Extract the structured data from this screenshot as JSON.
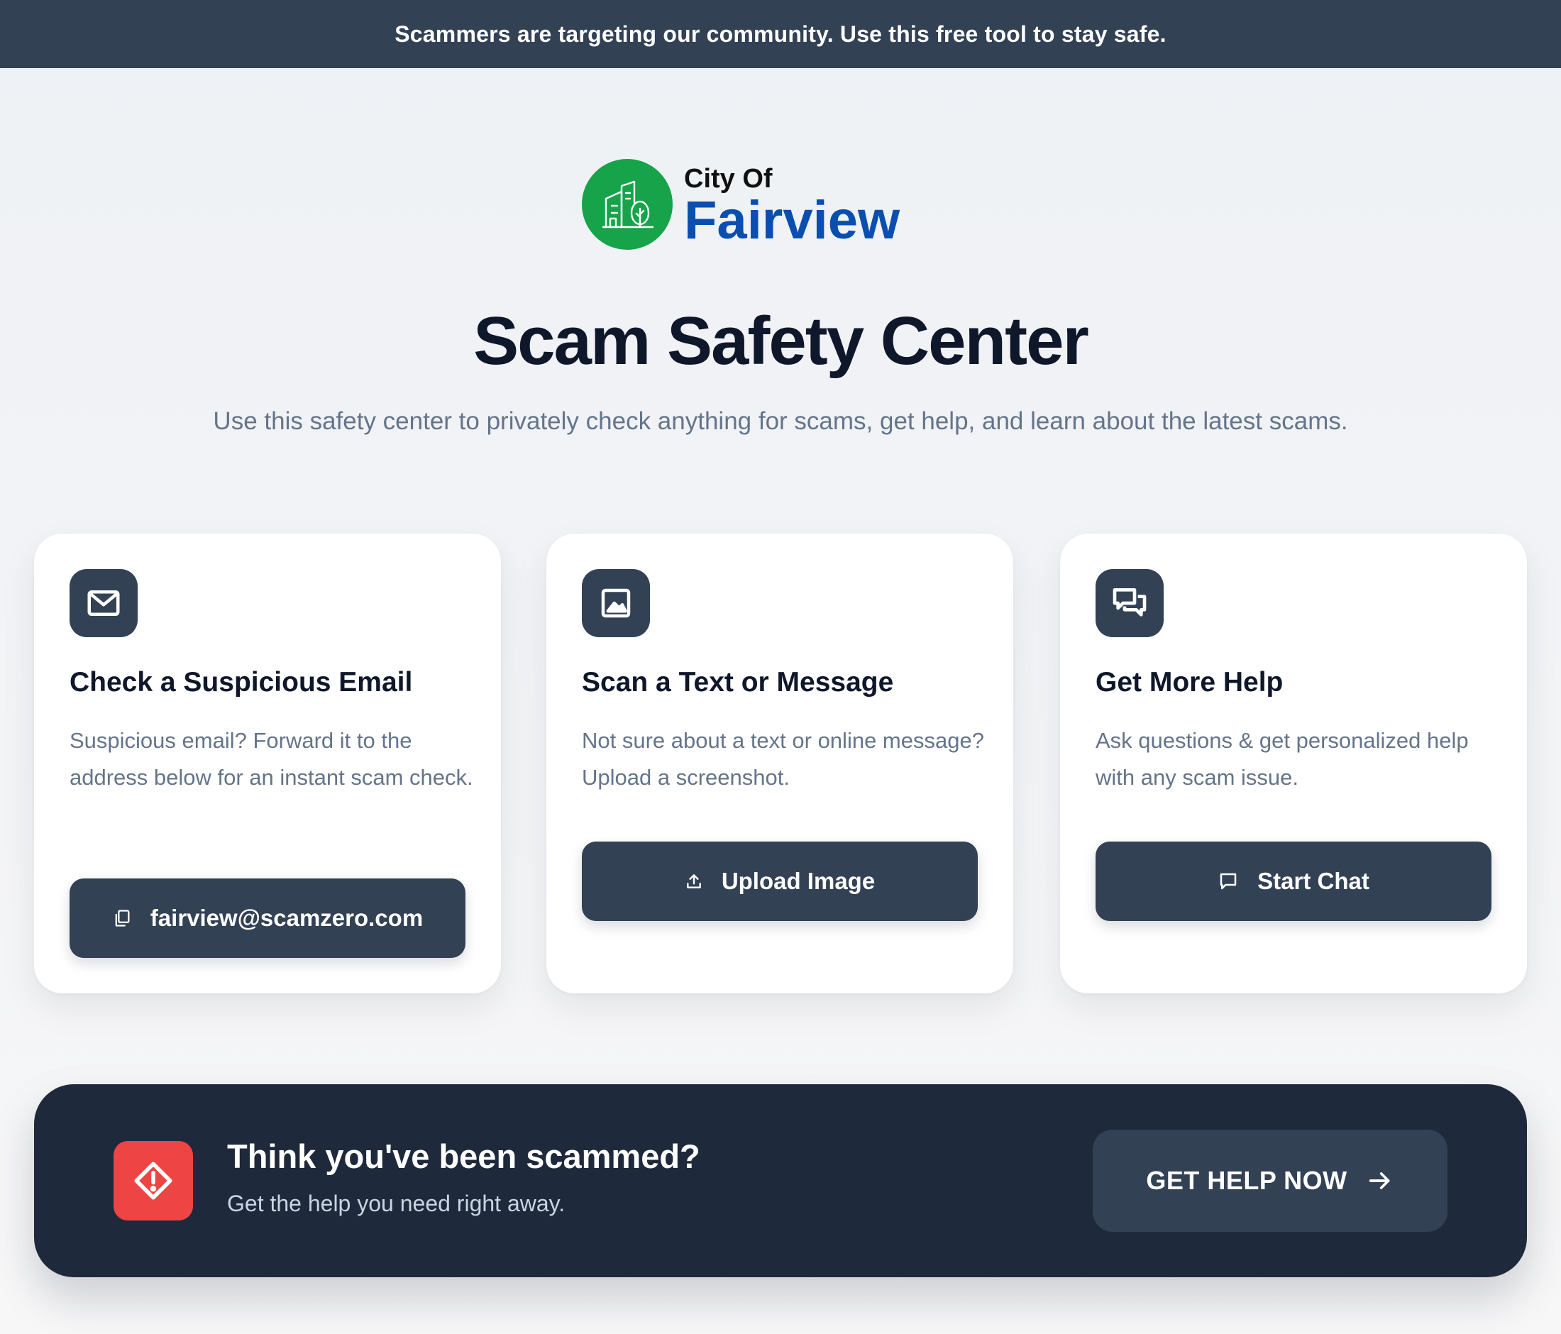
{
  "banner": {
    "text": "Scammers are targeting our community. Use this free tool to stay safe."
  },
  "logo": {
    "line1": "City Of",
    "line2": "Fairview",
    "icon": "building-tree-icon",
    "badge_color": "#16a34a",
    "name_color": "#0a4fb0"
  },
  "header": {
    "title": "Scam Safety Center",
    "subtitle": "Use this safety center to privately check anything for scams, get help, and learn about the latest scams."
  },
  "cards": [
    {
      "icon": "mail-icon",
      "title": "Check a Suspicious Email",
      "description": "Suspicious email? Forward it to the address below for an instant scam check.",
      "button_icon": "copy-icon",
      "button_label": "fairview@scamzero.com"
    },
    {
      "icon": "image-icon",
      "title": "Scan a Text or Message",
      "description": "Not sure about a text or online message? Upload a screenshot.",
      "button_icon": "upload-icon",
      "button_label": "Upload Image"
    },
    {
      "icon": "chat-bubbles-icon",
      "title": "Get More Help",
      "description": "Ask questions & get personalized help with any scam issue.",
      "button_icon": "chat-icon",
      "button_label": "Start Chat"
    }
  ],
  "cta": {
    "icon": "alert-diamond-icon",
    "alert_color": "#ef4444",
    "title": "Think you've been scammed?",
    "subtitle": "Get the help you need right away.",
    "button_label": "GET HELP NOW",
    "button_icon": "arrow-right-icon"
  },
  "colors": {
    "banner_bg": "#334155",
    "button_bg": "#334155",
    "panel_bg": "#1e293b"
  }
}
